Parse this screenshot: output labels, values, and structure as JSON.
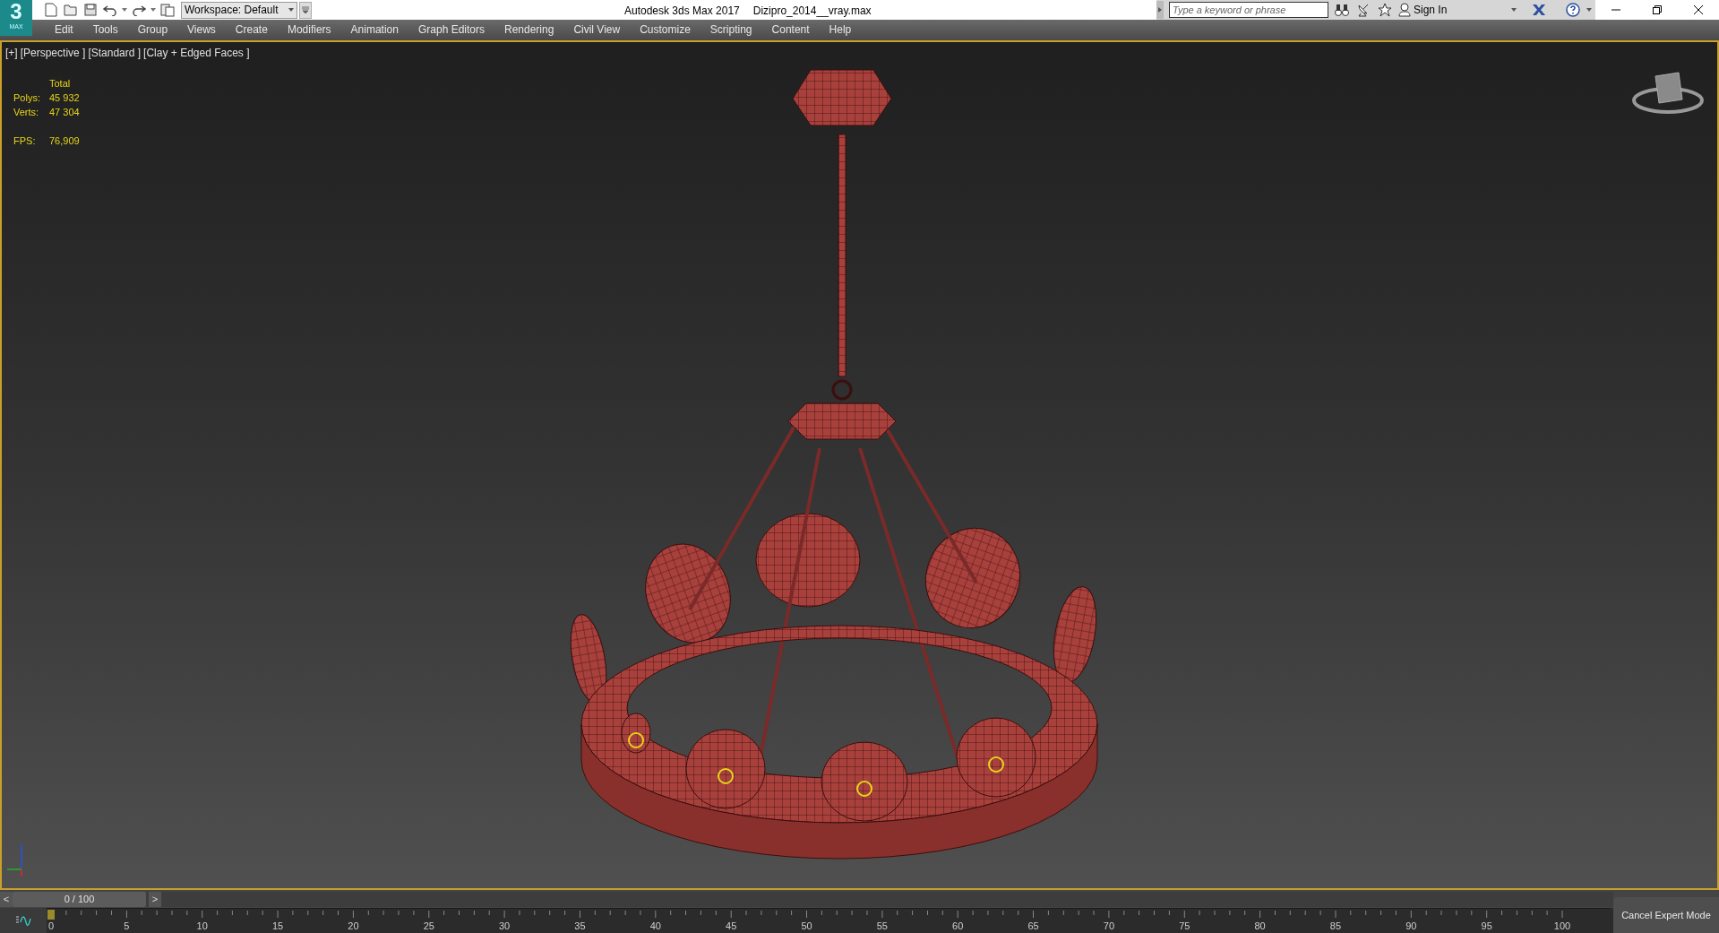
{
  "logo": {
    "text": "3",
    "subtext": "MAX"
  },
  "workspace": {
    "label": "Workspace: Default"
  },
  "window": {
    "title": "Autodesk 3ds Max 2017",
    "file": "Dizipro_2014__vray.max"
  },
  "search": {
    "placeholder": "Type a keyword or phrase"
  },
  "account": {
    "label": "Sign In"
  },
  "menu": [
    "Edit",
    "Tools",
    "Group",
    "Views",
    "Create",
    "Modifiers",
    "Animation",
    "Graph Editors",
    "Rendering",
    "Civil View",
    "Customize",
    "Scripting",
    "Content",
    "Help"
  ],
  "viewport": {
    "labels": [
      "[+]",
      "[Perspective ]",
      "[Standard ]",
      "[Clay + Edged Faces ]"
    ],
    "stats": {
      "header": "Total",
      "rows": [
        {
          "label": "Polys:",
          "value": "45 932"
        },
        {
          "label": "Verts:",
          "value": "47 304"
        }
      ],
      "fps_label": "FPS:",
      "fps_value": "76,909"
    }
  },
  "time_slider": {
    "prev": "<",
    "reading": "0 / 100",
    "next": ">",
    "level": 0
  },
  "track_bar": {
    "ticks": [
      "0",
      "5",
      "10",
      "15",
      "20",
      "25",
      "30",
      "35",
      "40",
      "45",
      "50",
      "55",
      "60",
      "65",
      "70",
      "75",
      "80",
      "85",
      "90",
      "95",
      "100"
    ]
  },
  "expert_button": "Cancel Expert Mode"
}
